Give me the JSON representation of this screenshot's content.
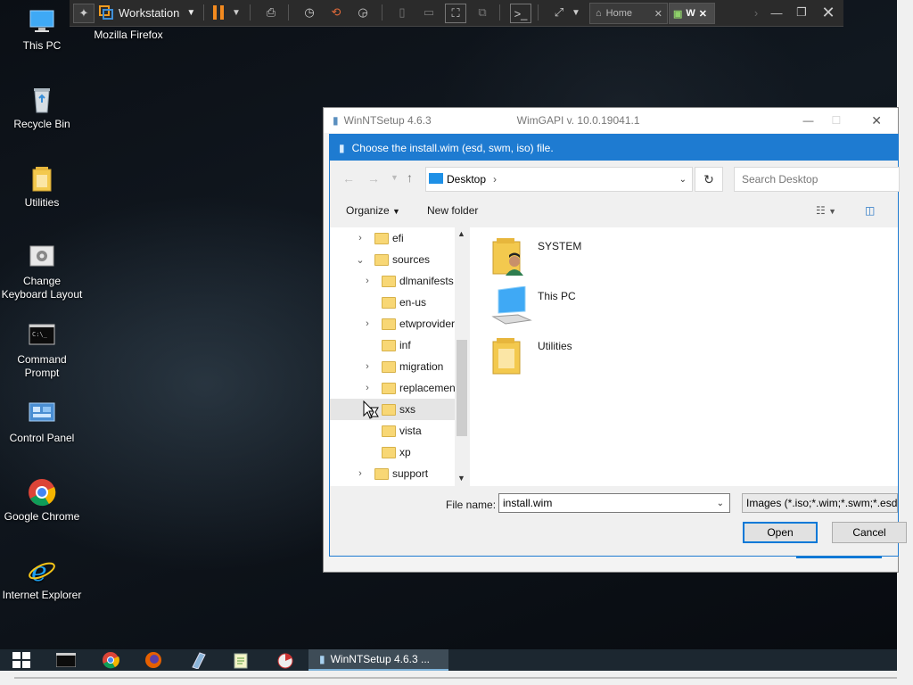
{
  "desktop": {
    "icons": [
      {
        "label": "This PC"
      },
      {
        "label": "Mozilla Firefox"
      },
      {
        "label": "Recycle Bin"
      },
      {
        "label": "Utilities"
      },
      {
        "label": "Change Keyboard Layout"
      },
      {
        "label": "Command Prompt"
      },
      {
        "label": "Control Panel"
      },
      {
        "label": "Google Chrome"
      },
      {
        "label": "Internet Explorer"
      }
    ]
  },
  "vmware_toolbar": {
    "workstation_label": "Workstation",
    "tabs": [
      {
        "label": "Home"
      },
      {
        "label": "W"
      }
    ]
  },
  "background_window": {
    "title": "WinNTSetup 4.6.3",
    "subtitle": "WimGAPI v. 10.0.19041.1"
  },
  "dialog": {
    "title": "Choose the install.wim (esd, swm, iso) file.",
    "address": "Desktop",
    "search_placeholder": "Search Desktop",
    "organize_label": "Organize",
    "new_folder_label": "New folder",
    "tree": [
      {
        "name": "efi"
      },
      {
        "name": "sources"
      },
      {
        "name": "dlmanifests"
      },
      {
        "name": "en-us"
      },
      {
        "name": "etwproviders"
      },
      {
        "name": "inf"
      },
      {
        "name": "migration"
      },
      {
        "name": "replacementmanifests"
      },
      {
        "name": "sxs"
      },
      {
        "name": "vista"
      },
      {
        "name": "xp"
      },
      {
        "name": "support"
      }
    ],
    "items": [
      {
        "name": "SYSTEM"
      },
      {
        "name": "This PC"
      },
      {
        "name": "Utilities"
      }
    ],
    "file_name_label": "File name:",
    "file_name_value": "install.wim",
    "filter_value": "Images (*.iso;*.wim;*.swm;*.esd)",
    "open_label": "Open",
    "cancel_label": "Cancel"
  },
  "taskbar": {
    "active_app_label": "WinNTSetup 4.6.3 ..."
  },
  "colors": {
    "accent": "#1e7bd1",
    "taskbar": "#1c2730",
    "folder": "#f8d775"
  }
}
